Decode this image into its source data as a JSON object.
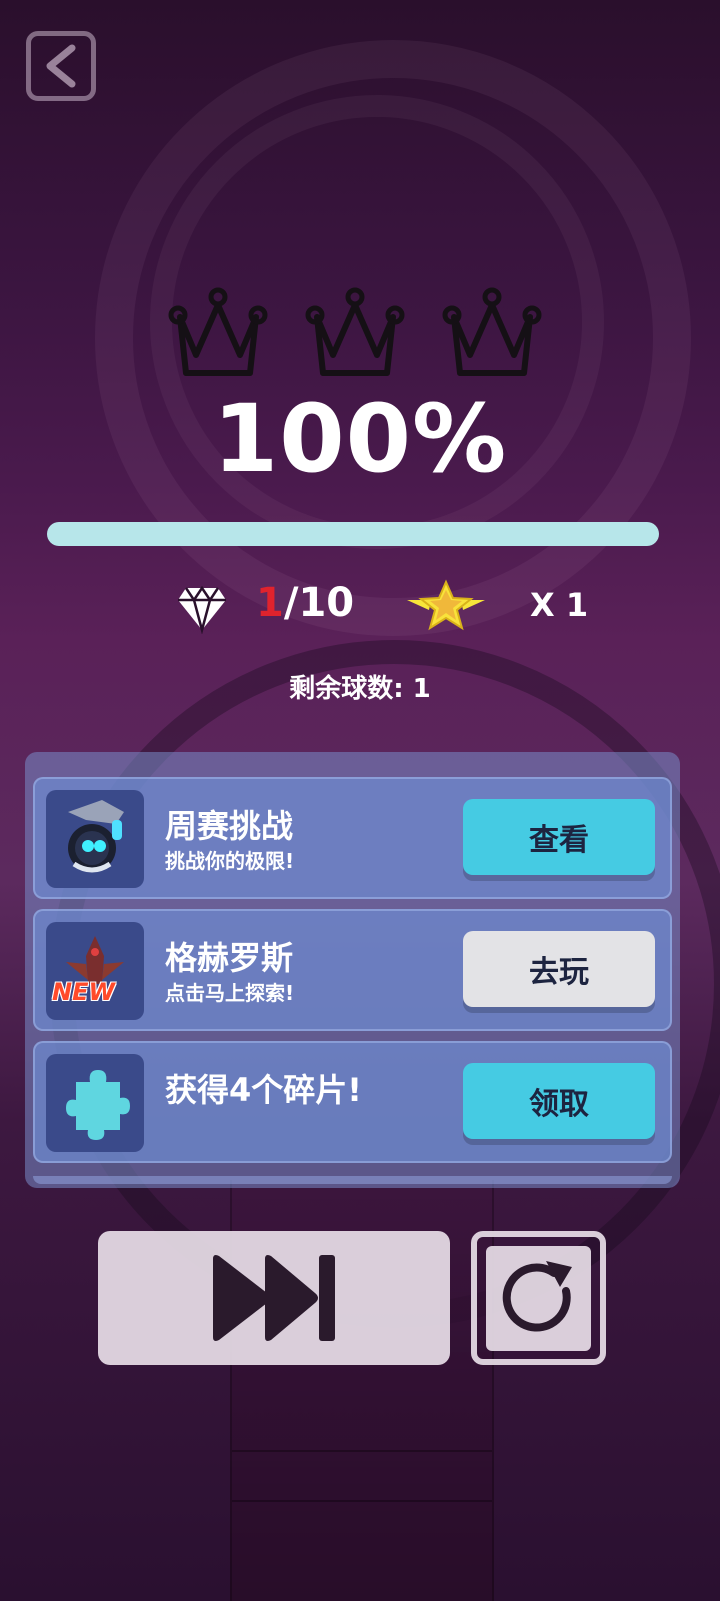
{
  "result": {
    "percent": "100%",
    "progress": 1.0,
    "crowns_earned": 0,
    "crowns_total": 3
  },
  "stats": {
    "gems_current": "1",
    "gems_total": "/10",
    "star_multiplier": "X 1",
    "balls_left": "剩余球数: 1"
  },
  "tasks": [
    {
      "title": "周赛挑战",
      "subtitle": "挑战你的极限!",
      "button": "查看",
      "button_style": "cyan",
      "icon": "robot-ball-icon"
    },
    {
      "title": "格赫罗斯",
      "subtitle": "点击马上探索!",
      "button": "去玩",
      "button_style": "gray",
      "icon": "new-level-icon",
      "badge": "NEW"
    },
    {
      "title": "获得4个碎片!",
      "subtitle": "",
      "button": "领取",
      "button_style": "cyan",
      "icon": "puzzle-piece-icon"
    }
  ],
  "colors": {
    "accent_cyan": "#45cbe3",
    "gem_current": "#e0232d",
    "progress": "#c8eef0"
  }
}
